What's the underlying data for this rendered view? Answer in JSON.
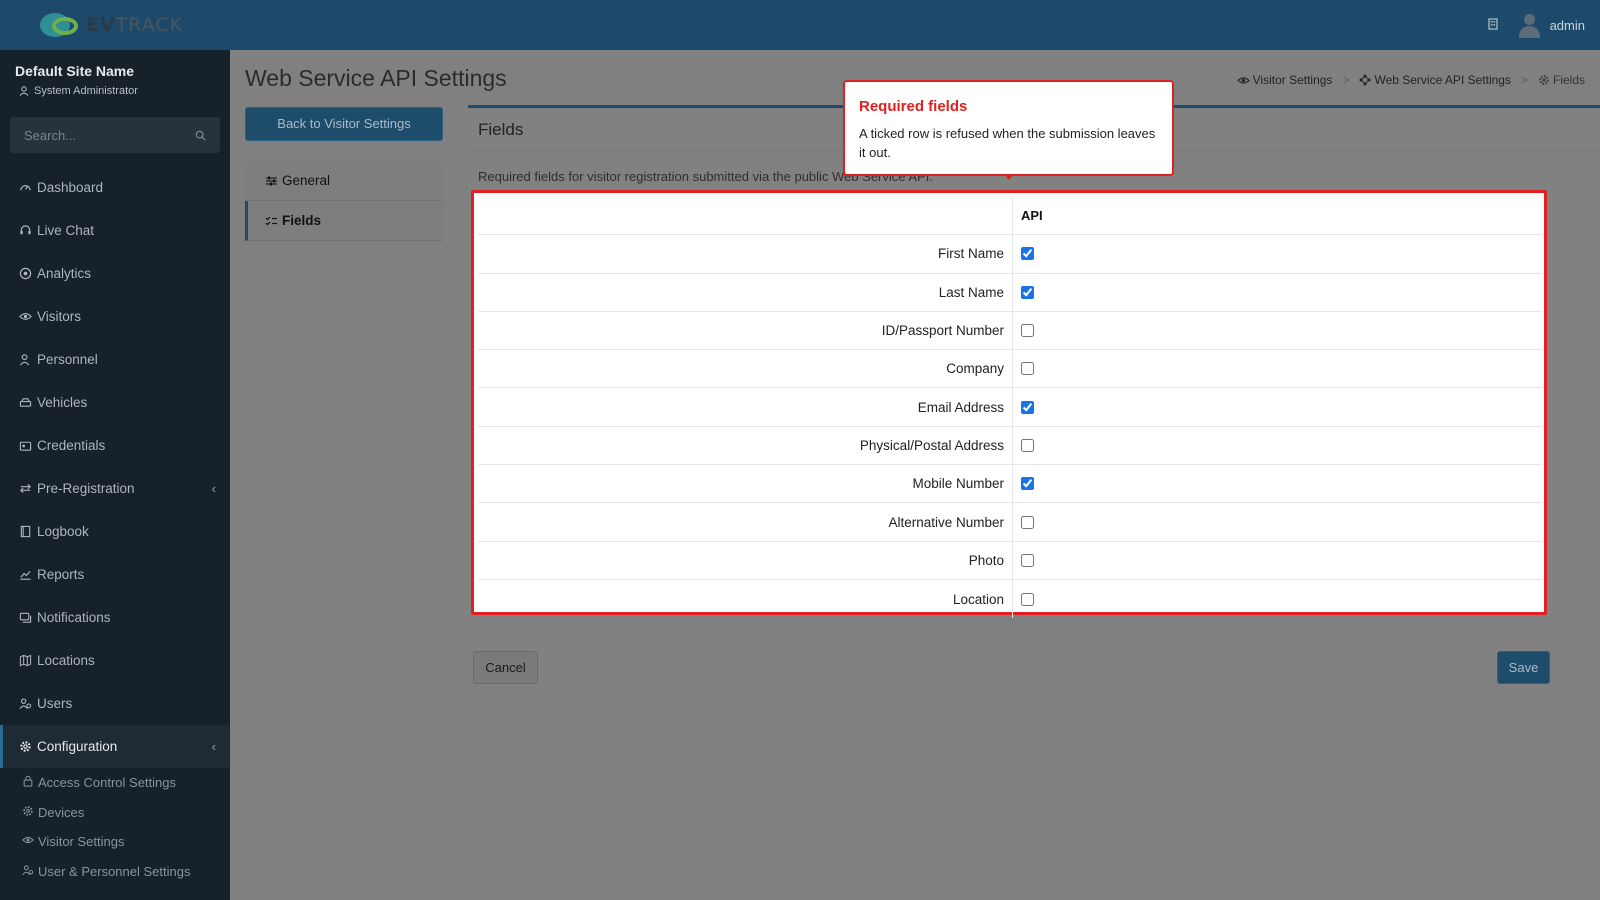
{
  "brand": {
    "name_bold": "EV",
    "name_rest": "TRACK"
  },
  "user_panel": {
    "site_name": "Default Site Name",
    "role": "System Administrator"
  },
  "search": {
    "placeholder": "Search..."
  },
  "topbar": {
    "username": "admin"
  },
  "nav": {
    "items": [
      {
        "label": "Dashboard",
        "icon": "dashboard-icon"
      },
      {
        "label": "Live Chat",
        "icon": "headset-icon"
      },
      {
        "label": "Analytics",
        "icon": "target-icon"
      },
      {
        "label": "Visitors",
        "icon": "eye-icon"
      },
      {
        "label": "Personnel",
        "icon": "user-icon"
      },
      {
        "label": "Vehicles",
        "icon": "car-icon"
      },
      {
        "label": "Credentials",
        "icon": "id-card-icon"
      },
      {
        "label": "Pre-Registration",
        "icon": "arrows-icon"
      },
      {
        "label": "Logbook",
        "icon": "book-icon"
      },
      {
        "label": "Reports",
        "icon": "chart-icon"
      },
      {
        "label": "Notifications",
        "icon": "bell-icon"
      },
      {
        "label": "Locations",
        "icon": "map-icon"
      },
      {
        "label": "Users",
        "icon": "users-icon"
      },
      {
        "label": "Configuration",
        "icon": "gear-icon"
      }
    ],
    "sub_items": [
      {
        "label": "Access Control Settings",
        "icon": "lock-icon"
      },
      {
        "label": "Devices",
        "icon": "gear-icon"
      },
      {
        "label": "Visitor Settings",
        "icon": "eye-icon"
      },
      {
        "label": "User & Personnel Settings",
        "icon": "users-icon"
      }
    ]
  },
  "page": {
    "title": "Web Service API Settings",
    "breadcrumb": [
      "Visitor Settings",
      "Web Service API Settings",
      "Fields"
    ],
    "back_button": "Back to Visitor Settings",
    "settings_nav": [
      "General",
      "Fields"
    ],
    "card_title": "Fields",
    "card_desc": "Required fields for visitor registration submitted via the public Web Service API.",
    "column_header": "API",
    "fields": [
      {
        "label": "First Name",
        "checked": true
      },
      {
        "label": "Last Name",
        "checked": true
      },
      {
        "label": "ID/Passport Number",
        "checked": false
      },
      {
        "label": "Company",
        "checked": false
      },
      {
        "label": "Email Address",
        "checked": true
      },
      {
        "label": "Physical/Postal Address",
        "checked": false
      },
      {
        "label": "Mobile Number",
        "checked": true
      },
      {
        "label": "Alternative Number",
        "checked": false
      },
      {
        "label": "Photo",
        "checked": false
      },
      {
        "label": "Location",
        "checked": false
      }
    ],
    "cancel_button": "Cancel",
    "save_button": "Save"
  },
  "callout": {
    "title": "Required fields",
    "text": "A ticked row is refused when the submission leaves it out."
  },
  "colors": {
    "brand_blue": "#1d4a6a",
    "highlight_red": "#e32020",
    "checkbox_blue": "#1a73e8"
  }
}
